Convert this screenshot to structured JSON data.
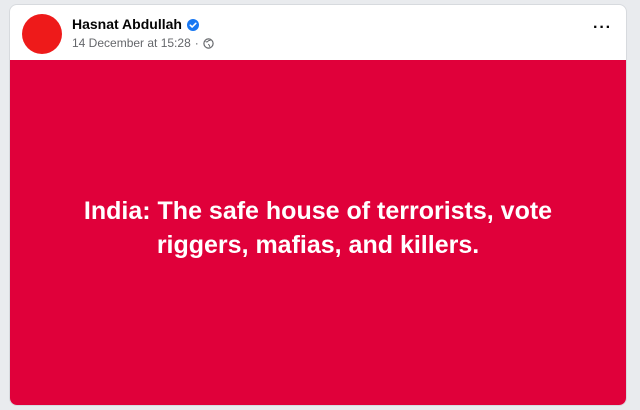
{
  "post": {
    "author": "Hasnat Abdullah",
    "verified": true,
    "timestamp": "14 December at 15:28",
    "separator": "·",
    "audience_icon": "globe-icon",
    "more_options": "···",
    "text": "India: The safe house of terrorists, vote riggers, mafias, and killers.",
    "background_color": "#e0003a",
    "avatar_color": "#ee1a1a"
  }
}
